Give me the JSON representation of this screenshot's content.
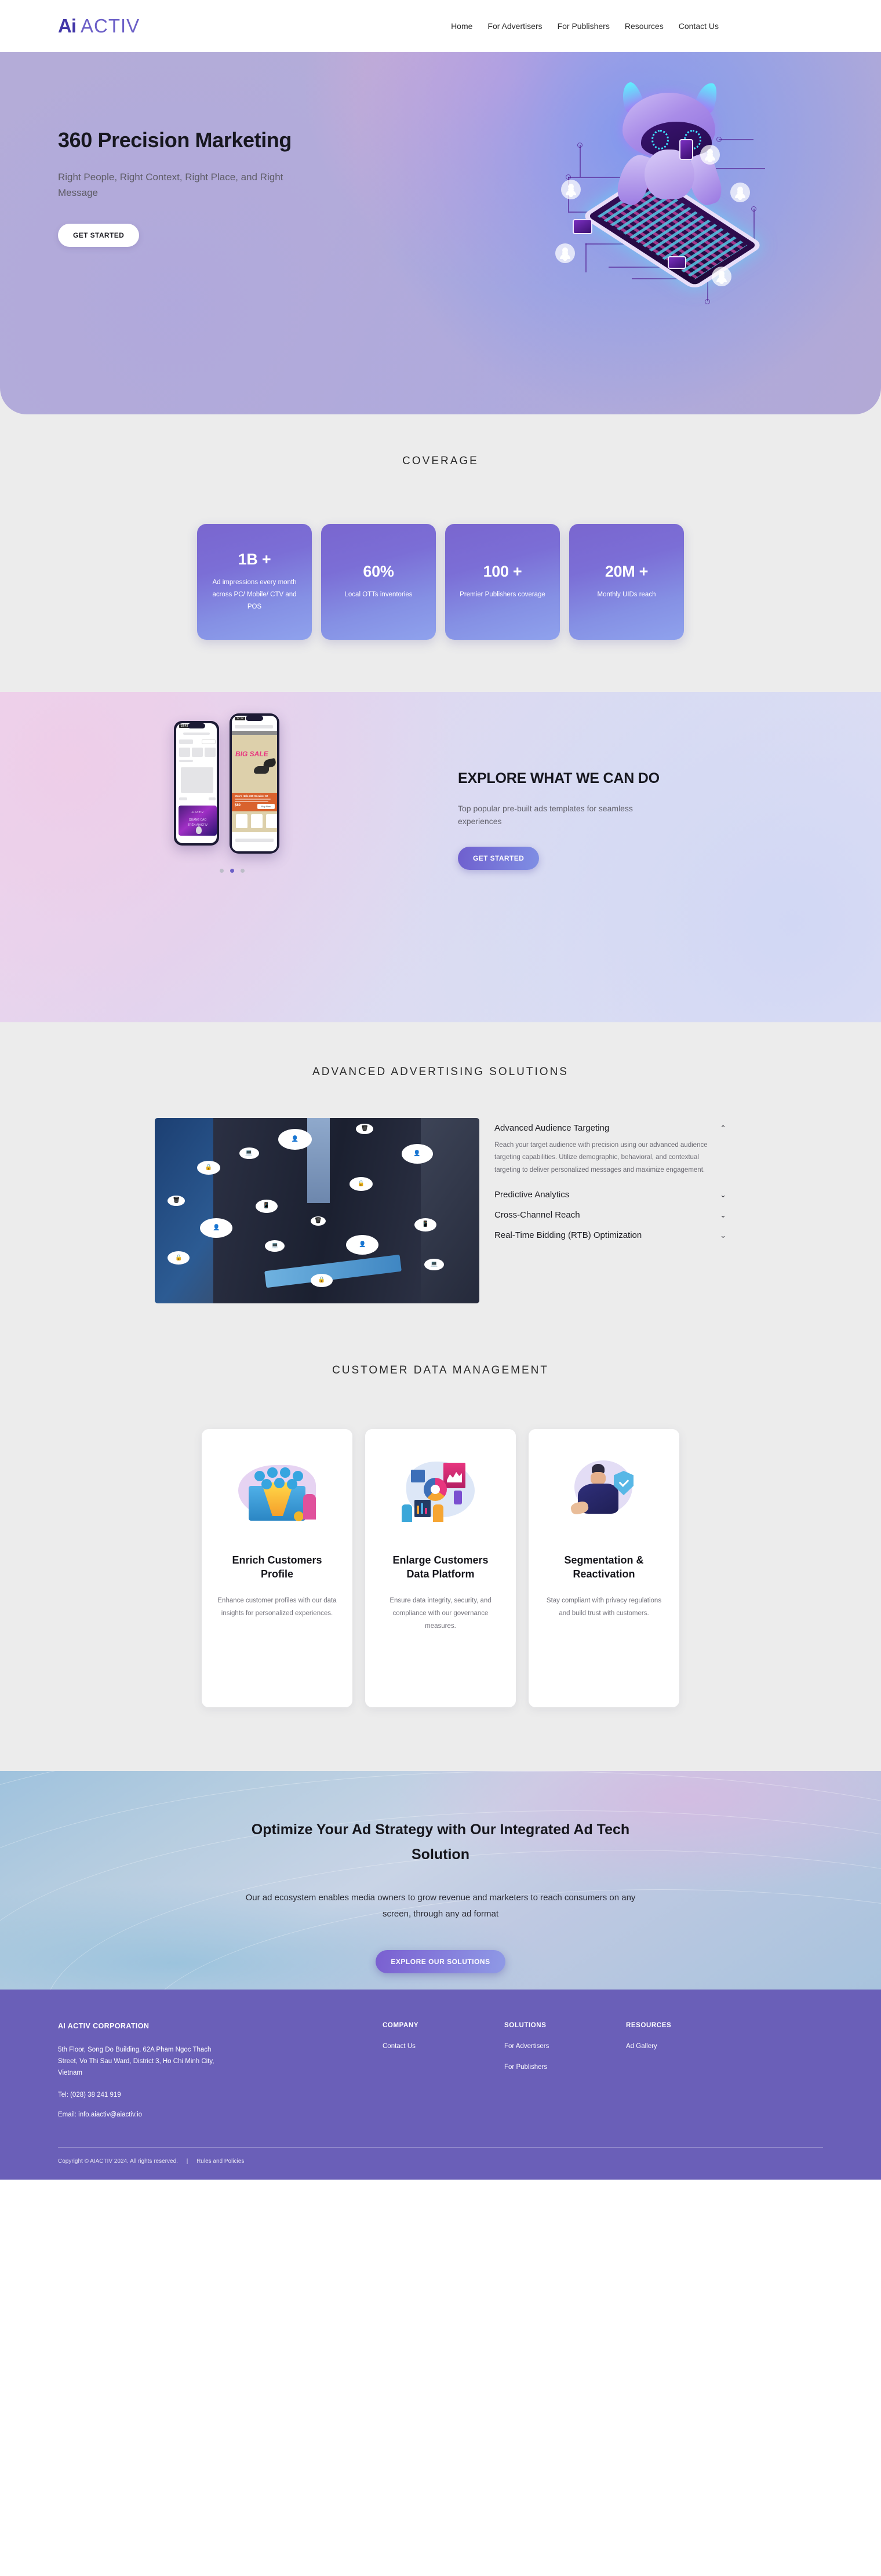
{
  "nav": {
    "logo_ai": "Ai",
    "logo_activ": "ACTIV",
    "links": [
      {
        "label": "Home"
      },
      {
        "label": "For Advertisers"
      },
      {
        "label": "For Publishers"
      },
      {
        "label": "Resources"
      },
      {
        "label": "Contact Us"
      }
    ]
  },
  "hero": {
    "title": "360 Precision Marketing",
    "subtitle": "Right People, Right Context, Right Place, and Right Message",
    "cta_label": "GET STARTED",
    "accent": "#b4aed8"
  },
  "coverage": {
    "title": "COVERAGE",
    "cards": [
      {
        "number": "1B +",
        "desc": "Ad impressions every month across PC/ Mobile/ CTV and POS"
      },
      {
        "number": "60%",
        "desc": "Local OTTs inventories"
      },
      {
        "number": "100 +",
        "desc": "Premier Publishers coverage"
      },
      {
        "number": "20M +",
        "desc": "Monthly UIDs reach"
      }
    ],
    "card_gradient_from": "#7a66cf",
    "card_gradient_to": "#8fa2ed"
  },
  "explore": {
    "title": "EXPLORE WHAT WE CAN DO",
    "subtitle": "Top popular pre-built ads templates for seamless experiences",
    "cta_label": "GET STARTED",
    "phone_left_time": "18:43",
    "phone_right_time": "17:12",
    "phone_left_banner_line1": "QUẢNG CÁO",
    "phone_left_banner_line2": "TRÊN AIACTIV",
    "phone_left_banner_logo": "AIACTIV",
    "phone_right_ad_title": "BIG SALE",
    "phone_right_product": "Men's Halo 360 Sneaker 02",
    "phone_right_price": "$89",
    "phone_right_cta": "Buy Now",
    "carousel_dots": 3,
    "carousel_active_index": 1
  },
  "solutions": {
    "title": "ADVANCED ADVERTISING SOLUTIONS",
    "items": [
      {
        "heading": "Advanced Audience Targeting",
        "expanded": true,
        "chevron": "⌃",
        "body": "Reach your target audience with precision using our advanced audience targeting capabilities. Utilize demographic, behavioral, and contextual targeting to deliver personalized messages and maximize engagement."
      },
      {
        "heading": "Predictive Analytics",
        "expanded": false,
        "chevron": "⌄",
        "body": ""
      },
      {
        "heading": "Cross-Channel Reach",
        "expanded": false,
        "chevron": "⌄",
        "body": ""
      },
      {
        "heading": "Real-Time Bidding (RTB) Optimization",
        "expanded": false,
        "chevron": "⌄",
        "body": ""
      }
    ]
  },
  "cdm": {
    "title": "CUSTOMER DATA MANAGEMENT",
    "cards": [
      {
        "heading": "Enrich Customers Profile",
        "desc": "Enhance customer profiles with our data insights for personalized experiences.",
        "icon": "funnel-audience-icon"
      },
      {
        "heading": "Enlarge Customers Data Platform",
        "desc": "Ensure data integrity, security, and compliance with our governance measures.",
        "icon": "analytics-dashboard-icon"
      },
      {
        "heading": "Segmentation & Reactivation",
        "desc": "Stay compliant with privacy regulations and build trust with customers.",
        "icon": "shield-check-icon"
      }
    ]
  },
  "cta": {
    "heading": "Optimize Your Ad Strategy with Our Integrated Ad Tech Solution",
    "paragraph": "Our ad ecosystem enables media owners to grow revenue and marketers to reach consumers on any screen, through any ad format",
    "button_label": "EXPLORE OUR SOLUTIONS"
  },
  "footer": {
    "brand": "AI ACTIV CORPORATION",
    "address": "5th Floor, Song Do Building, 62A Pham Ngoc Thach Street, Vo Thi Sau Ward, District 3, Ho Chi Minh City, Vietnam",
    "tel": "Tel: (028) 38 241 919",
    "email": "Email: info.aiactiv@aiactiv.io",
    "columns": [
      {
        "title": "COMPANY",
        "links": [
          {
            "label": "Contact Us"
          }
        ]
      },
      {
        "title": "SOLUTIONS",
        "links": [
          {
            "label": "For Advertisers"
          },
          {
            "label": "For Publishers"
          }
        ]
      },
      {
        "title": "RESOURCES",
        "links": [
          {
            "label": "Ad Gallery"
          }
        ]
      }
    ],
    "copyright": "Copyright © AIACTIV 2024. All rights reserved.",
    "separator": "|",
    "policy_link": "Rules and Policies",
    "background": "#6a5fb8"
  }
}
